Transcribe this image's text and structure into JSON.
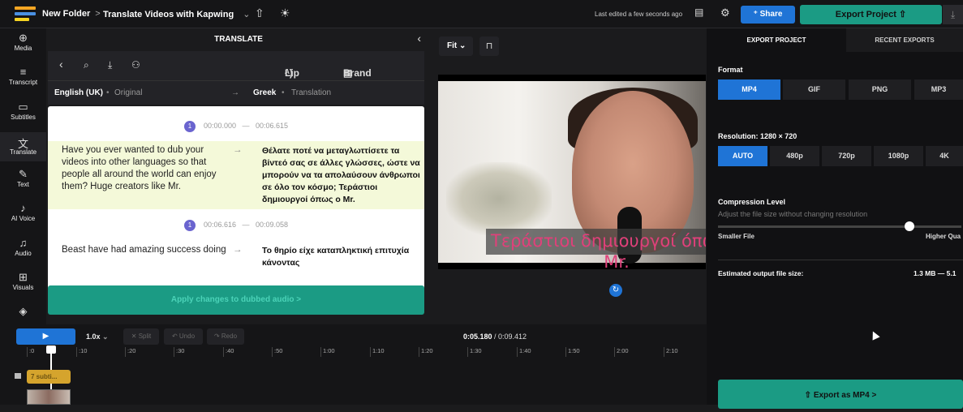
{
  "topbar": {
    "folder": "New Folder",
    "separator": ">",
    "project": "Translate Videos with Kapwing",
    "edited": "Last edited a few seconds ago",
    "share": "Share",
    "export_project": "Export Project"
  },
  "sidebar": {
    "items": [
      {
        "label": "Media",
        "icon": "media-icon"
      },
      {
        "label": "Transcript",
        "icon": "transcript-icon"
      },
      {
        "label": "Subtitles",
        "icon": "subtitles-icon"
      },
      {
        "label": "Translate",
        "icon": "translate-icon"
      },
      {
        "label": "Text",
        "icon": "text-icon"
      },
      {
        "label": "AI Voice",
        "icon": "ai-voice-icon"
      },
      {
        "label": "Audio",
        "icon": "audio-icon"
      },
      {
        "label": "Visuals",
        "icon": "visuals-icon"
      }
    ]
  },
  "translate": {
    "title": "TRANSLATE",
    "lip_sync": "Lip Sync",
    "brand_glossary": "Brand Glossary",
    "source_lang": "English (UK)",
    "source_tag": "Original",
    "target_lang": "Greek",
    "target_tag": "Translation",
    "segments": [
      {
        "num": "1",
        "start": "00:00.000",
        "end": "00:06.615",
        "source": "Have you ever wanted to dub your videos into other languages so that people all around the world can enjoy them? Huge creators like Mr.",
        "target": "Θέλατε ποτέ να μεταγλωττίσετε τα βίντεό σας σε άλλες γλώσσες, ώστε να μπορούν να τα απολαύσουν άνθρωποι σε όλο τον κόσμο; Τεράστιοι δημιουργοί όπως ο Mr."
      },
      {
        "num": "1",
        "start": "00:06.616",
        "end": "00:09.058",
        "source": "Beast have had amazing success doing",
        "target": "Το θηρίο είχε καταπληκτική επιτυχία κάνοντας"
      }
    ],
    "apply": "Apply changes to dubbed audio  >"
  },
  "preview": {
    "fit": "Fit",
    "subtitle": "Τεράστιοι δημιουργοί όπως ο Mr."
  },
  "export": {
    "tab_export": "EXPORT PROJECT",
    "tab_recent": "RECENT EXPORTS",
    "format_label": "Format",
    "formats": [
      "MP4",
      "GIF",
      "PNG",
      "MP3"
    ],
    "resolution_label": "Resolution: 1280 × 720",
    "resolutions": [
      "AUTO",
      "480p",
      "720p",
      "1080p",
      "4K"
    ],
    "compression_label": "Compression Level",
    "compression_hint": "Adjust the file size without changing resolution",
    "compression_level": 0.78,
    "smaller": "Smaller File",
    "higher": "Higher Qua",
    "est_label": "Estimated output file size:",
    "est_value": "1.3 MB — 5.1",
    "export_mp4": "Export as MP4  >"
  },
  "timeline": {
    "speed": "1.0x",
    "split": "Split",
    "undo": "Undo",
    "redo": "Redo",
    "current": "0:05.180",
    "total": " / 0:09.412",
    "ticks": [
      ":0",
      ":10",
      ":20",
      ":30",
      ":40",
      ":50",
      "1:00",
      "1:10",
      "1:20",
      "1:30",
      "1:40",
      "1:50",
      "2:00",
      "2:10"
    ],
    "clip": "7 subti..."
  },
  "colors": {
    "accent_blue": "#1f74d6",
    "accent_green": "#1b9b84",
    "subtitle_pink": "#e0407a",
    "clip_yellow": "#d5a42d"
  }
}
